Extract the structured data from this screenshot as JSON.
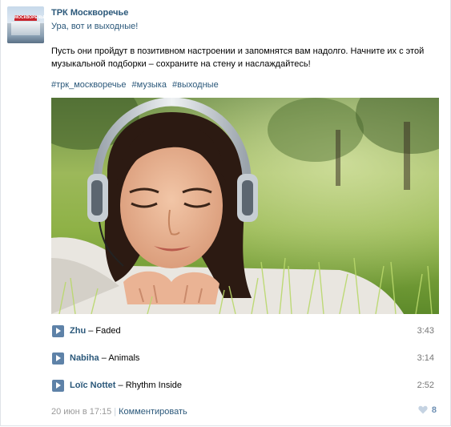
{
  "post": {
    "author": "ТРК Москворечье",
    "subtitle": "Ура, вот и выходные!",
    "text": "Пусть они пройдут в позитивном настроении и запомнятся вам надолго. Начните их с этой музыкальной подборки – сохраните на стену и наслаждайтесь!",
    "hashtags": [
      "#трк_москворечье",
      "#музыка",
      "#выходные"
    ],
    "avatar_sign": "МОСКВОРЕЧЬЕ"
  },
  "tracks": [
    {
      "artist": "Zhu",
      "dash": " – ",
      "title": "Faded",
      "duration": "3:43"
    },
    {
      "artist": "Nabiha",
      "dash": " – ",
      "title": "Animals",
      "duration": "3:14"
    },
    {
      "artist": "Loïc Nottet",
      "dash": " – ",
      "title": "Rhythm Inside",
      "duration": "2:52"
    }
  ],
  "footer": {
    "date": "20 июн в 17:15",
    "separator": "|",
    "comment_label": "Комментировать",
    "likes": "8"
  },
  "icons": {
    "play": "play-icon",
    "like": "heart-icon"
  },
  "colors": {
    "link": "#2b587a",
    "play_button": "#5e82a8",
    "like": "#6d8fb3"
  }
}
